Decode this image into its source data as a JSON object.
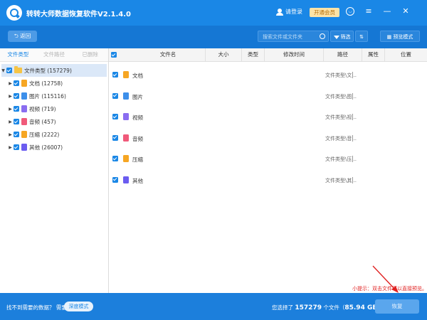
{
  "app": {
    "title": "转转大师数据恢复软件V2.1.4.0",
    "login_label": "请登录",
    "vip_label": "开通会员",
    "brand_color": "#1a87e6"
  },
  "window_controls": [
    "feedback-icon",
    "menu-icon",
    "minimize-icon",
    "close-icon"
  ],
  "toolbar": {
    "back_label": "返回",
    "search_placeholder": "搜索文件或文件夹",
    "filter_label": "筛选",
    "preview_label": "预览模式"
  },
  "sidebar": {
    "tabs": [
      {
        "label": "文件类型",
        "active": true
      },
      {
        "label": "文件路径",
        "active": false
      },
      {
        "label": "已删除",
        "active": false
      }
    ],
    "root": {
      "label": "文件类型 (157279)"
    },
    "items": [
      {
        "label": "文档 (12758)",
        "icon": "document-icon",
        "color": "#f6a623"
      },
      {
        "label": "图片 (115116)",
        "icon": "image-icon",
        "color": "#3d8fea"
      },
      {
        "label": "视频 (719)",
        "icon": "video-icon",
        "color": "#8a6df0"
      },
      {
        "label": "音频 (457)",
        "icon": "audio-icon",
        "color": "#f05a7a"
      },
      {
        "label": "压缩 (2222)",
        "icon": "archive-icon",
        "color": "#f6a623"
      },
      {
        "label": "其他 (26007)",
        "icon": "other-file-icon",
        "color": "#6b5cf0"
      }
    ]
  },
  "table": {
    "columns": [
      "文件名",
      "大小",
      "类型",
      "修改时间",
      "路径",
      "属性",
      "位置"
    ],
    "rows": [
      {
        "name": "文档",
        "path": "文件类型\\文...",
        "icon": "document-icon",
        "color": "#f6a623"
      },
      {
        "name": "图片",
        "path": "文件类型\\图...",
        "icon": "image-icon",
        "color": "#3d8fea"
      },
      {
        "name": "视频",
        "path": "文件类型\\视...",
        "icon": "video-icon",
        "color": "#8a6df0"
      },
      {
        "name": "音频",
        "path": "文件类型\\音...",
        "icon": "audio-icon",
        "color": "#f05a7a"
      },
      {
        "name": "压缩",
        "path": "文件类型\\压...",
        "icon": "archive-icon",
        "color": "#f6a623"
      },
      {
        "name": "其他",
        "path": "文件类型\\其...",
        "icon": "other-file-icon",
        "color": "#6b5cf0"
      }
    ]
  },
  "bottom": {
    "not_found_text": "找不到需要的数据？ 需要",
    "deep_scan_label": "深度模式",
    "hint_text": "小提示：双击文件可以直接预览。",
    "status_prefix": "您选择了",
    "selected_count": "157279",
    "status_mid": "个文件（",
    "selected_size": "85.94 GB",
    "status_suffix": "）",
    "recover_label": "恢复"
  }
}
